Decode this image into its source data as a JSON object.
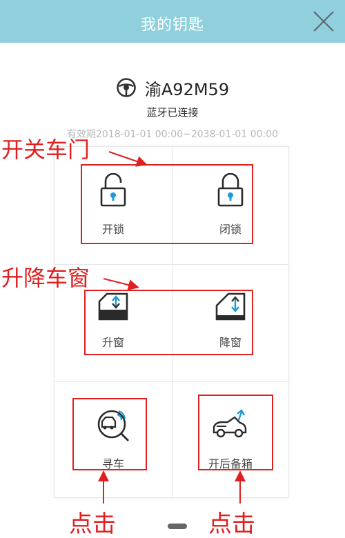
{
  "header": {
    "title": "我的钥匙"
  },
  "car": {
    "plate": "渝A92M59",
    "status": "蓝牙已连接",
    "validity": "有效期2018-01-01 00:00~2038-01-01 00:00"
  },
  "actions": {
    "unlock": "开锁",
    "lock": "闭锁",
    "window_up": "升窗",
    "window_down": "降窗",
    "find_car": "寻车",
    "open_trunk": "开后备箱"
  },
  "annotations": {
    "doors": "开关车门",
    "windows": "升降车窗",
    "click_left": "点击",
    "click_right": "点击"
  },
  "colors": {
    "header_bg": "#8fd0dc",
    "accent": "#1a9ad6",
    "annotation": "#e02020"
  }
}
